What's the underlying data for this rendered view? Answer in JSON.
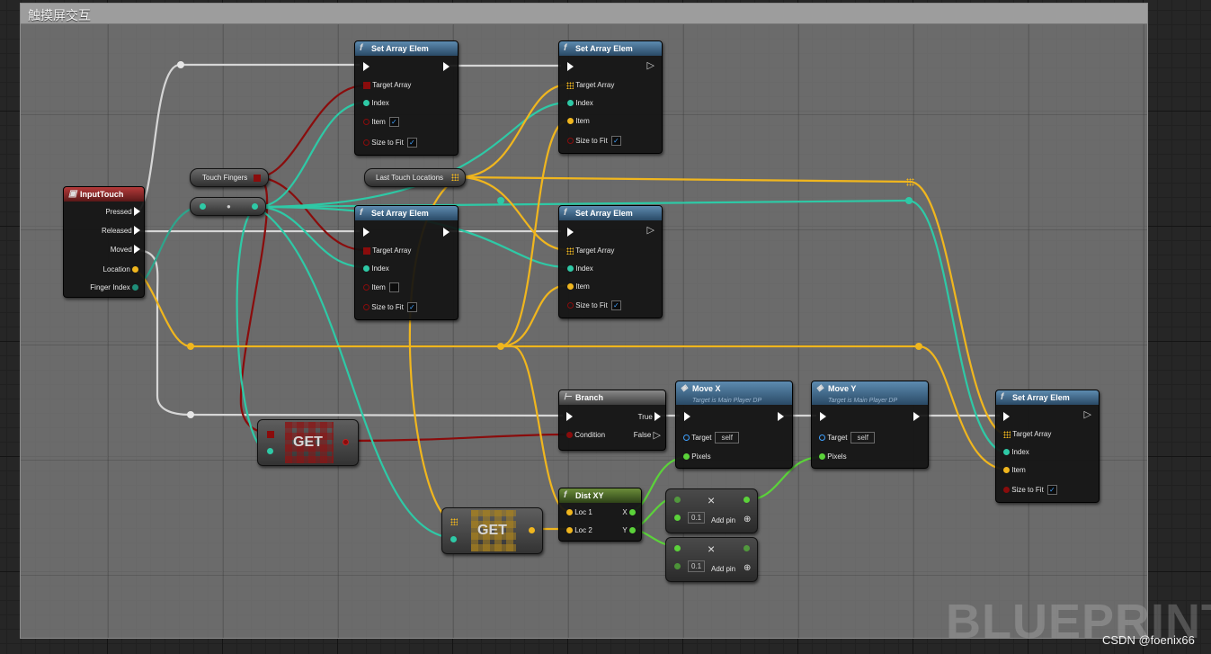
{
  "comment": {
    "title": "触摸屏交互"
  },
  "watermark": "BLUEPRINT",
  "credit": "CSDN @foenix66",
  "colors": {
    "exec": "#ffffff",
    "bool": "#8a0c0c",
    "int": "#2ec9a6",
    "vector": "#f0b61e",
    "float": "#5bd23a",
    "object": "#2f86c9"
  },
  "input_touch": {
    "title": "InputTouch",
    "pins": [
      "Pressed",
      "Released",
      "Moved",
      "Location",
      "Finger Index"
    ]
  },
  "var_touch_fingers": "Touch Fingers",
  "var_last_touch": "Last Touch Locations",
  "set_array_1": {
    "title": "Set Array Elem",
    "pins": [
      "Target Array",
      "Index",
      "Item",
      "Size to Fit"
    ]
  },
  "set_array_2": {
    "title": "Set Array Elem",
    "pins": [
      "Target Array",
      "Index",
      "Item",
      "Size to Fit"
    ]
  },
  "set_array_3": {
    "title": "Set Array Elem",
    "pins": [
      "Target Array",
      "Index",
      "Item",
      "Size to Fit"
    ]
  },
  "set_array_4": {
    "title": "Set Array Elem",
    "pins": [
      "Target Array",
      "Index",
      "Item",
      "Size to Fit"
    ]
  },
  "set_array_5": {
    "title": "Set Array Elem",
    "pins": [
      "Target Array",
      "Index",
      "Item",
      "Size to Fit"
    ]
  },
  "get_bool": "GET",
  "get_vec": "GET",
  "branch": {
    "title": "Branch",
    "condition": "Condition",
    "true": "True",
    "false": "False"
  },
  "move_x": {
    "title": "Move X",
    "subtitle": "Target is Main Player DP",
    "target": "Target",
    "self": "self",
    "pixels": "Pixels"
  },
  "move_y": {
    "title": "Move Y",
    "subtitle": "Target is Main Player DP",
    "target": "Target",
    "self": "self",
    "pixels": "Pixels"
  },
  "dist_xy": {
    "title": "Dist XY",
    "loc1": "Loc 1",
    "loc2": "Loc 2",
    "x": "X",
    "y": "Y"
  },
  "mult_1": {
    "value": "0.1",
    "add_pin": "Add pin",
    "op": "×"
  },
  "mult_2": {
    "value": "0.1",
    "add_pin": "Add pin",
    "op": "×"
  }
}
